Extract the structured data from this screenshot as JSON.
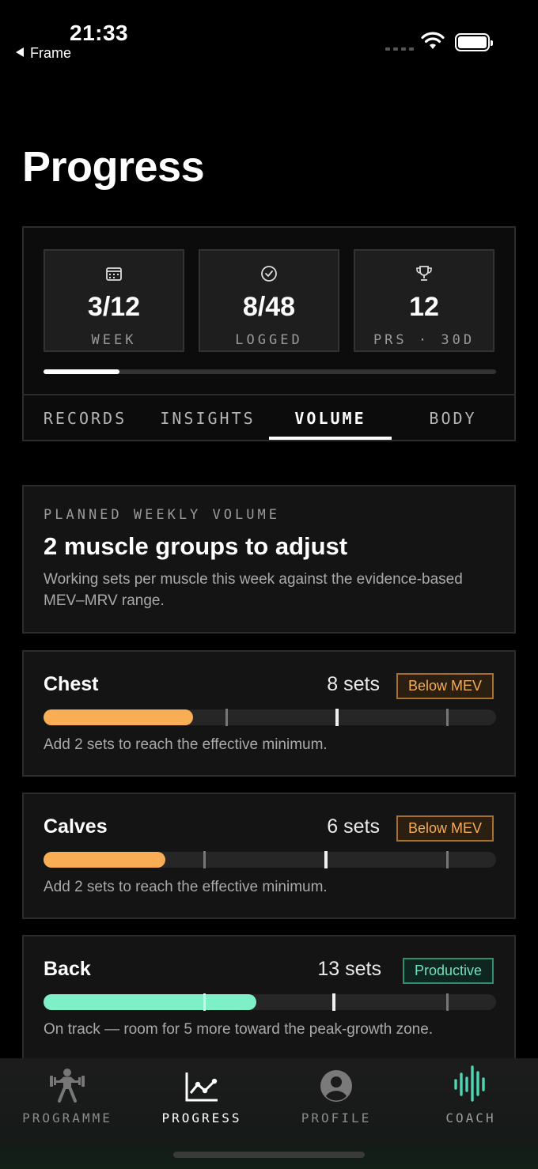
{
  "status_bar": {
    "time": "21:33",
    "back_label": "Frame"
  },
  "page": {
    "title": "Progress"
  },
  "summary": {
    "stats": [
      {
        "icon": "calendar-icon",
        "value": "3/12",
        "label": "WEEK"
      },
      {
        "icon": "check-circle-icon",
        "value": "8/48",
        "label": "LOGGED"
      },
      {
        "icon": "trophy-icon",
        "value": "12",
        "label": "PRS · 30D"
      }
    ],
    "progress_fraction": 0.167
  },
  "tabs": [
    {
      "label": "RECORDS",
      "active": false
    },
    {
      "label": "INSIGHTS",
      "active": false
    },
    {
      "label": "VOLUME",
      "active": true
    },
    {
      "label": "BODY",
      "active": false
    }
  ],
  "volume_header": {
    "kicker": "PLANNED WEEKLY VOLUME",
    "headline": "2 muscle groups to adjust",
    "description": "Working sets per muscle this week against the evidence-based MEV–MRV range."
  },
  "muscles": [
    {
      "name": "Chest",
      "sets": "8 sets",
      "status": "Below MEV",
      "status_color": "#f4ad55",
      "fill_fraction": 0.33,
      "note": "Add 2 sets to reach the effective minimum."
    },
    {
      "name": "Calves",
      "sets": "6 sets",
      "status": "Below MEV",
      "status_color": "#f4ad55",
      "fill_fraction": 0.27,
      "note": "Add 2 sets to reach the effective minimum."
    },
    {
      "name": "Back",
      "sets": "13 sets",
      "status": "Productive",
      "status_color": "#6ee2bd",
      "fill_fraction": 0.47,
      "note": "On track — room for 5 more toward the peak-growth zone."
    }
  ],
  "bottom_nav": [
    {
      "label": "PROGRAMME",
      "icon": "weightlifter-icon",
      "active": false
    },
    {
      "label": "PROGRESS",
      "icon": "line-chart-icon",
      "active": true
    },
    {
      "label": "PROFILE",
      "icon": "profile-icon",
      "active": false
    },
    {
      "label": "COACH",
      "icon": "waveform-icon",
      "active": false
    }
  ],
  "colors": {
    "accent_amber": "#f9ad55",
    "accent_teal": "#7ef0c8",
    "background": "#000000"
  }
}
